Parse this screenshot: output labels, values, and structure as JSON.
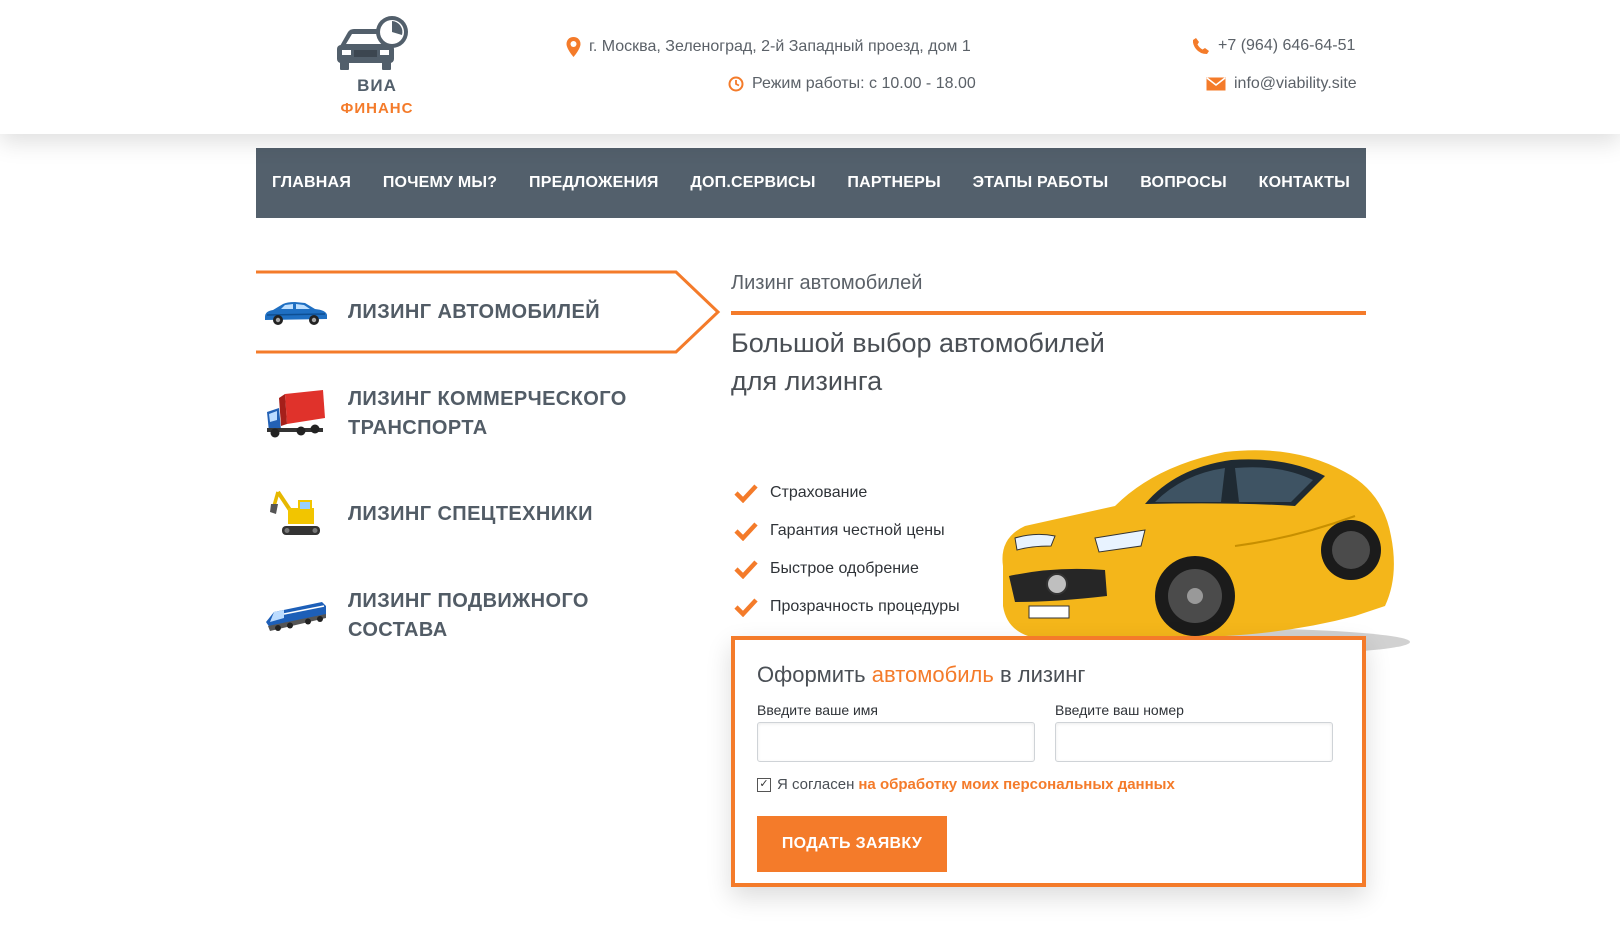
{
  "brand": {
    "line1": "ВИА",
    "line2": "ФИНАНС"
  },
  "header": {
    "address": "г. Москва, Зеленоград, 2-й Западный проезд, дом 1",
    "hours": "Режим работы: с 10.00 - 18.00",
    "phone": "+7 (964) 646-64-51",
    "email": "info@viability.site"
  },
  "nav": {
    "items": [
      {
        "label": "ГЛАВНАЯ"
      },
      {
        "label": "ПОЧЕМУ МЫ?"
      },
      {
        "label": "ПРЕДЛОЖЕНИЯ"
      },
      {
        "label": "ДОП.СЕРВИСЫ"
      },
      {
        "label": "ПАРТНЕРЫ"
      },
      {
        "label": "ЭТАПЫ РАБОТЫ"
      },
      {
        "label": "ВОПРОСЫ"
      },
      {
        "label": "КОНТАКТЫ"
      }
    ]
  },
  "menu": {
    "items": [
      {
        "line1": "ЛИЗИНГ АВТОМОБИЛЕЙ",
        "line2": "",
        "icon": "car-icon",
        "active": true
      },
      {
        "line1": "ЛИЗИНГ КОММЕРЧЕСКОГО",
        "line2": "ТРАНСПОРТА",
        "icon": "truck-icon",
        "active": false
      },
      {
        "line1": "ЛИЗИНГ СПЕЦТЕХНИКИ",
        "line2": "",
        "icon": "excavator-icon",
        "active": false
      },
      {
        "line1": "ЛИЗИНГ ПОДВИЖНОГО",
        "line2": "СОСТАВА",
        "icon": "locomotive-icon",
        "active": false
      }
    ]
  },
  "content": {
    "section_title": "Лизинг автомобилей",
    "headline_line1": "Большой выбор автомобилей",
    "headline_line2": "для лизинга",
    "features": [
      "Страхование",
      "Гарантия честной цены",
      "Быстрое одобрение",
      "Прозрачность процедуры"
    ]
  },
  "form": {
    "title_before": "Оформить",
    "title_accent": "автомобиль",
    "title_after": "в лизинг",
    "name_label": "Введите ваше имя",
    "name_value": "",
    "phone_label": "Введите ваш номер",
    "phone_value": "",
    "agree_text": "Я согласен",
    "agree_link": "на обработку моих персональных данных",
    "agree_checked": true,
    "submit_label": "ПОДАТЬ ЗАЯВКУ"
  },
  "colors": {
    "accent": "#f47b2a",
    "nav_bg": "#53606c",
    "text": "#4a4f55"
  }
}
